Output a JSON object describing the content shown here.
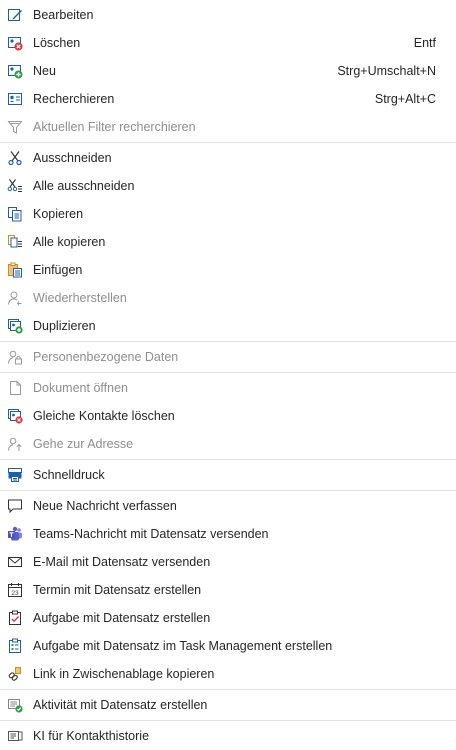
{
  "menu": {
    "items": [
      {
        "label": "Bearbeiten",
        "shortcut": "",
        "icon": "edit-icon",
        "disabled": false
      },
      {
        "label": "Löschen",
        "shortcut": "Entf",
        "icon": "delete-card-icon",
        "disabled": false
      },
      {
        "label": "Neu",
        "shortcut": "Strg+Umschalt+N",
        "icon": "new-card-icon",
        "disabled": false
      },
      {
        "label": "Recherchieren",
        "shortcut": "Strg+Alt+C",
        "icon": "research-card-icon",
        "disabled": false
      },
      {
        "label": "Aktuellen Filter recherchieren",
        "shortcut": "",
        "icon": "filter-icon",
        "disabled": true
      },
      {
        "label": "Ausschneiden",
        "shortcut": "",
        "icon": "cut-icon",
        "disabled": false
      },
      {
        "label": "Alle ausschneiden",
        "shortcut": "",
        "icon": "cut-all-icon",
        "disabled": false
      },
      {
        "label": "Kopieren",
        "shortcut": "",
        "icon": "copy-icon",
        "disabled": false
      },
      {
        "label": "Alle kopieren",
        "shortcut": "",
        "icon": "copy-all-icon",
        "disabled": false
      },
      {
        "label": "Einfügen",
        "shortcut": "",
        "icon": "paste-icon",
        "disabled": false
      },
      {
        "label": "Wiederherstellen",
        "shortcut": "",
        "icon": "restore-person-icon",
        "disabled": true
      },
      {
        "label": "Duplizieren",
        "shortcut": "",
        "icon": "duplicate-icon",
        "disabled": false
      },
      {
        "label": "Personenbezogene Daten",
        "shortcut": "",
        "icon": "personal-data-lock-icon",
        "disabled": true
      },
      {
        "label": "Dokument öffnen",
        "shortcut": "",
        "icon": "document-icon",
        "disabled": true
      },
      {
        "label": "Gleiche Kontakte löschen",
        "shortcut": "",
        "icon": "delete-duplicates-icon",
        "disabled": false
      },
      {
        "label": "Gehe zur Adresse",
        "shortcut": "",
        "icon": "goto-address-icon",
        "disabled": true
      },
      {
        "label": "Schnelldruck",
        "shortcut": "",
        "icon": "quick-print-icon",
        "disabled": false
      },
      {
        "label": "Neue Nachricht verfassen",
        "shortcut": "",
        "icon": "speech-bubble-icon",
        "disabled": false
      },
      {
        "label": "Teams-Nachricht mit Datensatz versenden",
        "shortcut": "",
        "icon": "teams-icon",
        "disabled": false
      },
      {
        "label": "E-Mail mit Datensatz versenden",
        "shortcut": "",
        "icon": "mail-icon",
        "disabled": false
      },
      {
        "label": "Termin mit Datensatz erstellen",
        "shortcut": "",
        "icon": "calendar-icon",
        "disabled": false
      },
      {
        "label": "Aufgabe mit Datensatz erstellen",
        "shortcut": "",
        "icon": "task-icon",
        "disabled": false
      },
      {
        "label": "Aufgabe mit Datensatz im Task Management erstellen",
        "shortcut": "",
        "icon": "task-management-icon",
        "disabled": false
      },
      {
        "label": "Link in Zwischenablage kopieren",
        "shortcut": "",
        "icon": "link-icon",
        "disabled": false
      },
      {
        "label": "Aktivität mit Datensatz erstellen",
        "shortcut": "",
        "icon": "activity-icon",
        "disabled": false
      },
      {
        "label": "KI für Kontakthistorie",
        "shortcut": "",
        "icon": "ai-history-icon",
        "disabled": false
      }
    ]
  },
  "colors": {
    "red": "#d9363e",
    "green": "#2e9a4a",
    "blue": "#1f5faa",
    "orange": "#d98a1f",
    "purple": "#5b5fc7",
    "gray": "#9a9a9a"
  }
}
